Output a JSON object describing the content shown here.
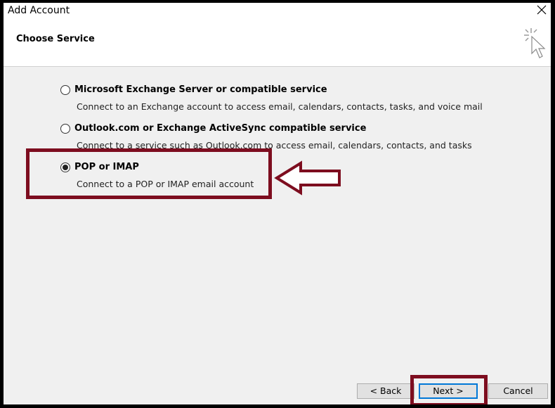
{
  "window": {
    "title": "Add Account"
  },
  "header": {
    "title": "Choose Service"
  },
  "options": [
    {
      "label": "Microsoft Exchange Server or compatible service",
      "description": "Connect to an Exchange account to access email, calendars, contacts, tasks, and voice mail",
      "selected": false
    },
    {
      "label": "Outlook.com or Exchange ActiveSync compatible service",
      "description": "Connect to a service such as Outlook.com to access email, calendars, contacts, and tasks",
      "selected": false
    },
    {
      "label": "POP or IMAP",
      "description": "Connect to a POP or IMAP email account",
      "selected": true
    }
  ],
  "buttons": {
    "back": "< Back",
    "next": "Next >",
    "cancel": "Cancel"
  },
  "colors": {
    "highlight": "#7d0d1f",
    "focus": "#0078d7"
  }
}
